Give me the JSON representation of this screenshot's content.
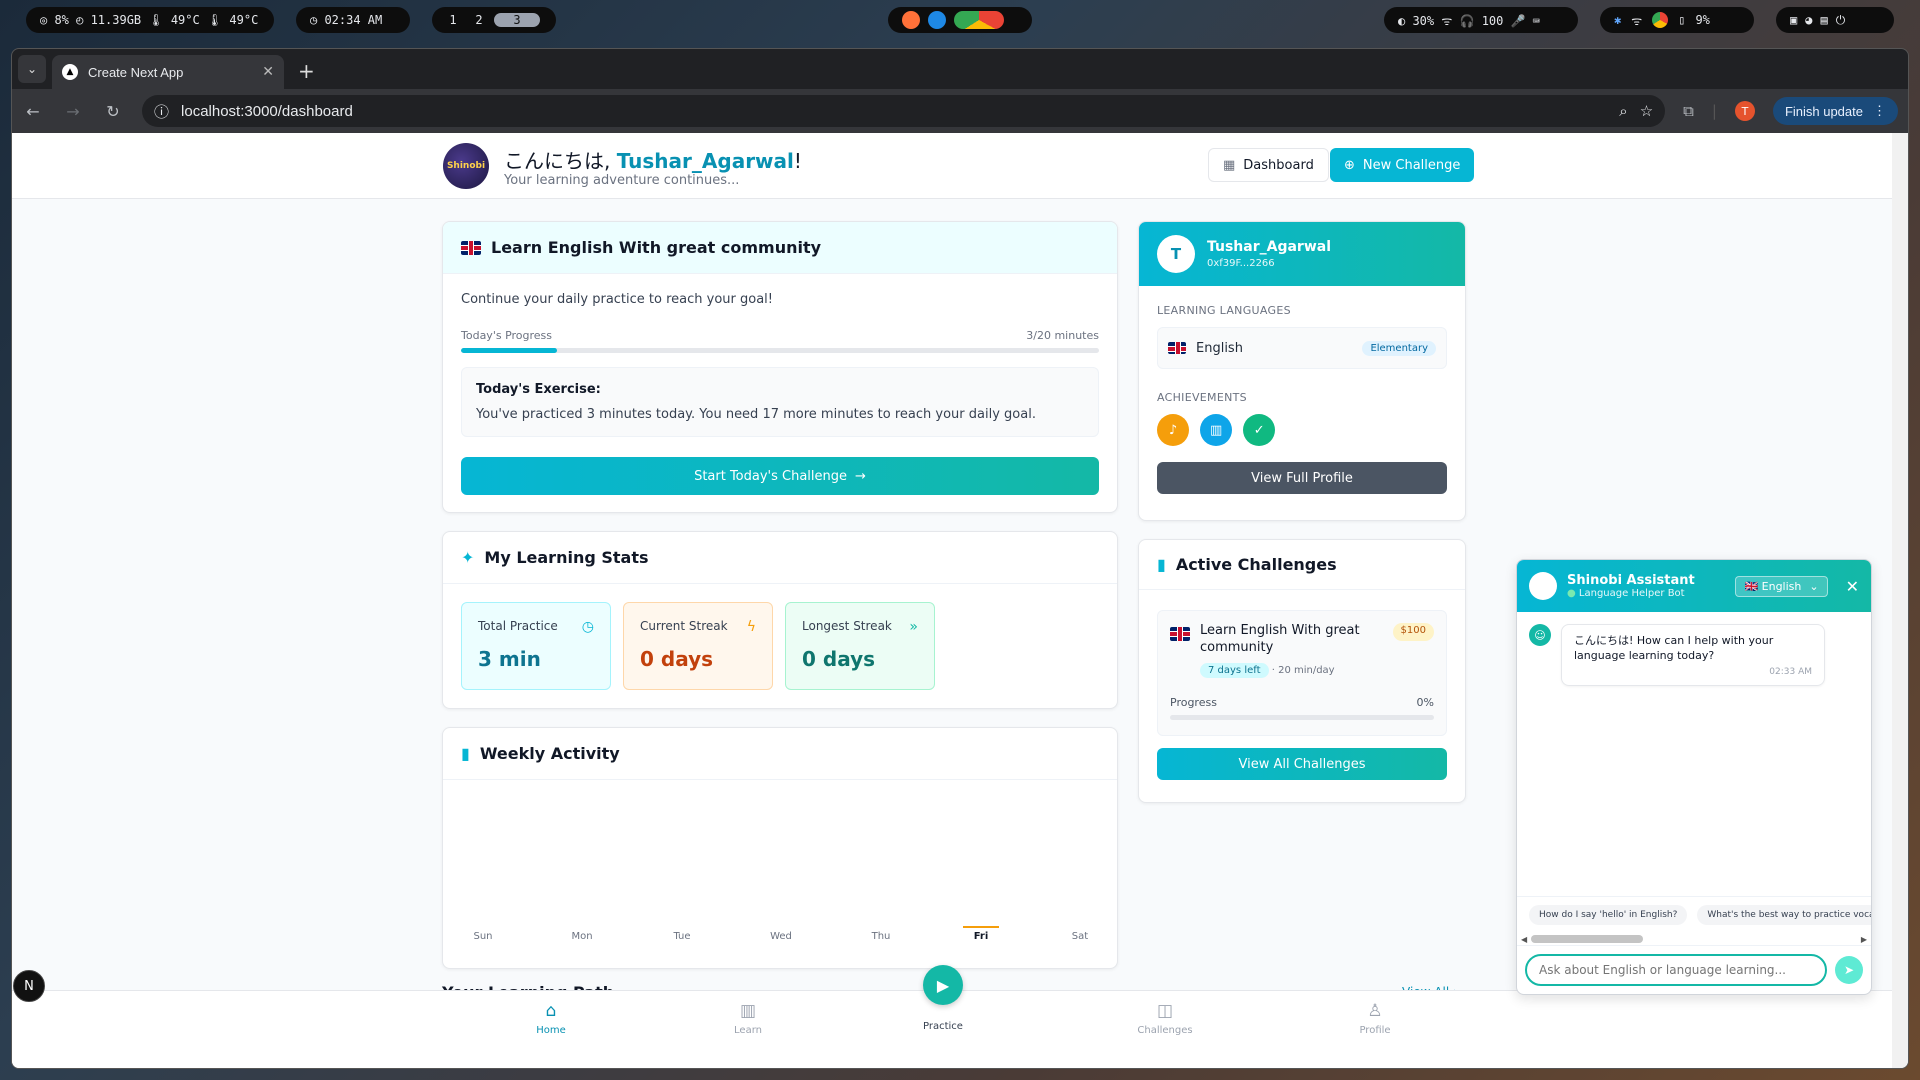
{
  "sysbar": {
    "stats": "◎ 8%  ◴ 11.39GB  🌡 49°C  🌡 49°C",
    "clock": "◷ 02:34 AM",
    "workspaces": [
      "1",
      "2",
      "3"
    ],
    "right_status": "◐ 30%   ᯤ  🎧 100  🎤  ⌨",
    "battery": "9%"
  },
  "browser": {
    "tab_title": "Create Next App",
    "url": "localhost:3000/dashboard",
    "finish_update": "Finish update",
    "profile_initial": "T"
  },
  "header": {
    "greeting_prefix": "こんにちは, ",
    "username": "Tushar_Agarwal",
    "greeting_suffix": "!",
    "subtitle": "Your learning adventure continues...",
    "logo_text": "Shinobi",
    "dashboard_btn": "Dashboard",
    "new_challenge_btn": "New Challenge"
  },
  "daily": {
    "title": "Learn English With great community",
    "intro": "Continue your daily practice to reach your goal!",
    "progress_label": "Today's Progress",
    "progress_value": "3/20 minutes",
    "progress_fraction": 0.15,
    "exercise_title": "Today's Exercise:",
    "exercise_text": "You've practiced 3 minutes today. You need 17 more minutes to reach your daily goal.",
    "cta": "Start Today's Challenge"
  },
  "stats": {
    "title": "My Learning Stats",
    "items": [
      {
        "label": "Total Practice",
        "value": "3 min",
        "color": "#0e7490"
      },
      {
        "label": "Current Streak",
        "value": "0 days",
        "color": "#c2410c"
      },
      {
        "label": "Longest Streak",
        "value": "0 days",
        "color": "#0f766e"
      }
    ]
  },
  "weekly": {
    "title": "Weekly Activity",
    "days": [
      "Sun",
      "Mon",
      "Tue",
      "Wed",
      "Thu",
      "Fri",
      "Sat"
    ],
    "current_day": "Fri"
  },
  "path": {
    "title": "Your Learning Path",
    "view_all": "View All"
  },
  "profile": {
    "initial": "T",
    "name": "Tushar_Agarwal",
    "wallet": "0xf39F...2266",
    "languages_title": "LEARNING LANGUAGES",
    "language": "English",
    "level": "Elementary",
    "achievements_title": "ACHIEVEMENTS",
    "view_profile": "View Full Profile"
  },
  "challenges": {
    "title": "Active Challenges",
    "item_title": "Learn English With great community",
    "stake": "$100",
    "days_left": "7 days left",
    "per_day": "20 min/day",
    "progress_label": "Progress",
    "progress_value": "0%",
    "view_all": "View All Challenges"
  },
  "nav": {
    "home": "Home",
    "learn": "Learn",
    "practice": "Practice",
    "challenges": "Challenges",
    "profile": "Profile"
  },
  "chat": {
    "title": "Shinobi Assistant",
    "subtitle": "Language Helper Bot",
    "language": "🇬🇧 English",
    "message": "こんにちは! How can I help with your language learning today?",
    "time": "02:33 AM",
    "suggestions": [
      "How do I say 'hello' in English?",
      "What's the best way to practice vocabu"
    ],
    "placeholder": "Ask about English or language learning..."
  }
}
